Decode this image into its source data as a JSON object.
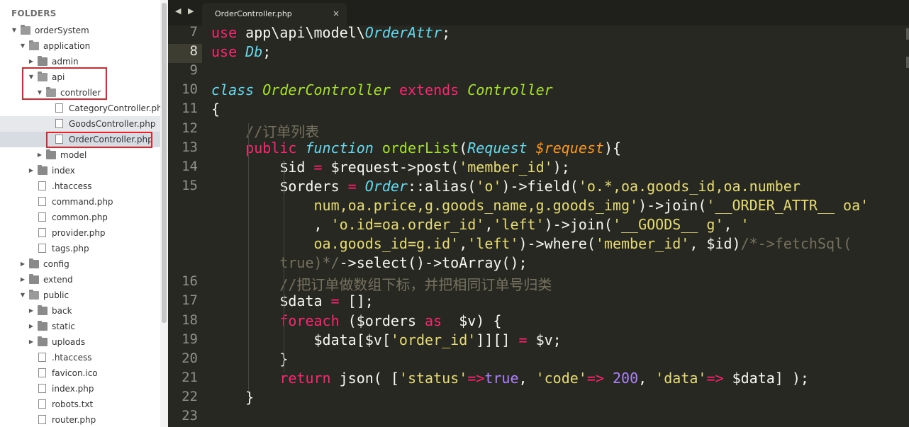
{
  "sidebar": {
    "header": "FOLDERS",
    "items": [
      {
        "label": "orderSystem",
        "type": "folder",
        "open": true,
        "depth": 0
      },
      {
        "label": "application",
        "type": "folder",
        "open": true,
        "depth": 1
      },
      {
        "label": "admin",
        "type": "folder",
        "open": false,
        "depth": 2
      },
      {
        "label": "api",
        "type": "folder",
        "open": true,
        "depth": 2
      },
      {
        "label": "controller",
        "type": "folder",
        "open": true,
        "depth": 3
      },
      {
        "label": "CategoryController.php",
        "type": "file",
        "depth": 4
      },
      {
        "label": "GoodsController.php",
        "type": "file",
        "depth": 4
      },
      {
        "label": "OrderController.php",
        "type": "file",
        "depth": 4,
        "selected": true
      },
      {
        "label": "model",
        "type": "folder",
        "open": false,
        "depth": 3
      },
      {
        "label": "index",
        "type": "folder",
        "open": false,
        "depth": 2
      },
      {
        "label": ".htaccess",
        "type": "file",
        "depth": 2
      },
      {
        "label": "command.php",
        "type": "file",
        "depth": 2
      },
      {
        "label": "common.php",
        "type": "file",
        "depth": 2
      },
      {
        "label": "provider.php",
        "type": "file",
        "depth": 2
      },
      {
        "label": "tags.php",
        "type": "file",
        "depth": 2
      },
      {
        "label": "config",
        "type": "folder",
        "open": false,
        "depth": 1
      },
      {
        "label": "extend",
        "type": "folder",
        "open": false,
        "depth": 1
      },
      {
        "label": "public",
        "type": "folder",
        "open": true,
        "depth": 1
      },
      {
        "label": "back",
        "type": "folder",
        "open": false,
        "depth": 2
      },
      {
        "label": "static",
        "type": "folder",
        "open": false,
        "depth": 2
      },
      {
        "label": "uploads",
        "type": "folder",
        "open": false,
        "depth": 2
      },
      {
        "label": ".htaccess",
        "type": "file",
        "depth": 2
      },
      {
        "label": "favicon.ico",
        "type": "image",
        "depth": 2
      },
      {
        "label": "index.php",
        "type": "file",
        "depth": 2
      },
      {
        "label": "robots.txt",
        "type": "text",
        "depth": 2
      },
      {
        "label": "router.php",
        "type": "file",
        "depth": 2
      }
    ]
  },
  "tabbar": {
    "nav": "◀ ▶",
    "active_tab": "OrderController.php",
    "close": "×"
  },
  "editor": {
    "active_line": "8",
    "gutter": [
      {
        "n": "7",
        "row": 0
      },
      {
        "n": "8",
        "row": 1
      },
      {
        "n": "9",
        "row": 2
      },
      {
        "n": "10",
        "row": 3
      },
      {
        "n": "11",
        "row": 4
      },
      {
        "n": "12",
        "row": 5
      },
      {
        "n": "13",
        "row": 6
      },
      {
        "n": "14",
        "row": 7
      },
      {
        "n": "15",
        "row": 8
      },
      {
        "n": "16",
        "row": 13
      },
      {
        "n": "17",
        "row": 14
      },
      {
        "n": "18",
        "row": 15
      },
      {
        "n": "19",
        "row": 16
      },
      {
        "n": "20",
        "row": 17
      },
      {
        "n": "21",
        "row": 18
      },
      {
        "n": "22",
        "row": 19
      },
      {
        "n": "23",
        "row": 20
      }
    ],
    "lines": [
      [
        [
          "kw",
          "use"
        ],
        [
          "pl",
          " app\\api\\model\\"
        ],
        [
          "st",
          "OrderAttr"
        ],
        [
          "pl",
          ";"
        ]
      ],
      [
        [
          "kw",
          "use"
        ],
        [
          "pl",
          " "
        ],
        [
          "st",
          "Db"
        ],
        [
          "pl",
          ";"
        ]
      ],
      [],
      [
        [
          "st",
          "class"
        ],
        [
          "pl",
          " "
        ],
        [
          "cl",
          "OrderController"
        ],
        [
          "pl",
          " "
        ],
        [
          "kw",
          "extends"
        ],
        [
          "pl",
          " "
        ],
        [
          "cl",
          "Controller"
        ]
      ],
      [
        [
          "pl",
          "{"
        ]
      ],
      [
        [
          "pl",
          "    "
        ],
        [
          "cm",
          "//订单列表"
        ]
      ],
      [
        [
          "pl",
          "    "
        ],
        [
          "kw",
          "public"
        ],
        [
          "pl",
          " "
        ],
        [
          "st",
          "function"
        ],
        [
          "pl",
          " "
        ],
        [
          "fn",
          "orderList"
        ],
        [
          "pl",
          "("
        ],
        [
          "st",
          "Request"
        ],
        [
          "pl",
          " "
        ],
        [
          "vr",
          "$request"
        ],
        [
          "pl",
          "){"
        ]
      ],
      [
        [
          "pl",
          "        $id "
        ],
        [
          "kw",
          "="
        ],
        [
          "pl",
          " $request->post("
        ],
        [
          "str",
          "'member_id'"
        ],
        [
          "pl",
          ");"
        ]
      ],
      [
        [
          "pl",
          "        $orders "
        ],
        [
          "kw",
          "="
        ],
        [
          "pl",
          " "
        ],
        [
          "st",
          "Order"
        ],
        [
          "pl",
          "::alias("
        ],
        [
          "str",
          "'o'"
        ],
        [
          "pl",
          ")->field("
        ],
        [
          "str",
          "'o.*,oa.goods_id,oa.number"
        ]
      ],
      [
        [
          "str",
          "            num,oa.price,g.goods_name,g.goods_img'"
        ],
        [
          "pl",
          ")->join("
        ],
        [
          "str",
          "'__ORDER_ATTR__ oa'"
        ]
      ],
      [
        [
          "pl",
          "            , "
        ],
        [
          "str",
          "'o.id=oa.order_id'"
        ],
        [
          "pl",
          ","
        ],
        [
          "str",
          "'left'"
        ],
        [
          "pl",
          ")->join("
        ],
        [
          "str",
          "'__GOODS__ g'"
        ],
        [
          "pl",
          ", "
        ],
        [
          "str",
          "'"
        ]
      ],
      [
        [
          "str",
          "            oa.goods_id=g.id'"
        ],
        [
          "pl",
          ","
        ],
        [
          "str",
          "'left'"
        ],
        [
          "pl",
          ")->where("
        ],
        [
          "str",
          "'member_id'"
        ],
        [
          "pl",
          ", $id)"
        ],
        [
          "cm",
          "/*->fetchSql("
        ]
      ],
      [
        [
          "cm",
          "        true)*/"
        ],
        [
          "pl",
          "->select()->toArray();"
        ]
      ],
      [
        [
          "pl",
          "        "
        ],
        [
          "cm",
          "//把订单做数组下标，并把相同订单号归类"
        ]
      ],
      [
        [
          "pl",
          "        $data "
        ],
        [
          "kw",
          "="
        ],
        [
          "pl",
          " [];"
        ]
      ],
      [
        [
          "pl",
          "        "
        ],
        [
          "kw",
          "foreach"
        ],
        [
          "pl",
          " ($orders "
        ],
        [
          "kw",
          "as"
        ],
        [
          "pl",
          "  $v) {"
        ]
      ],
      [
        [
          "pl",
          "            $data[$v["
        ],
        [
          "str",
          "'order_id'"
        ],
        [
          "pl",
          "]][] "
        ],
        [
          "kw",
          "="
        ],
        [
          "pl",
          " $v;"
        ]
      ],
      [
        [
          "pl",
          "        }"
        ]
      ],
      [
        [
          "pl",
          "        "
        ],
        [
          "kw",
          "return"
        ],
        [
          "pl",
          " json( ["
        ],
        [
          "str",
          "'status'"
        ],
        [
          "kw",
          "=>"
        ],
        [
          "cons",
          "true"
        ],
        [
          "pl",
          ", "
        ],
        [
          "str",
          "'code'"
        ],
        [
          "kw",
          "=>"
        ],
        [
          "pl",
          " "
        ],
        [
          "num",
          "200"
        ],
        [
          "pl",
          ", "
        ],
        [
          "str",
          "'data'"
        ],
        [
          "kw",
          "=>"
        ],
        [
          "pl",
          " $data] );"
        ]
      ],
      [
        [
          "pl",
          "    }"
        ]
      ],
      []
    ]
  }
}
